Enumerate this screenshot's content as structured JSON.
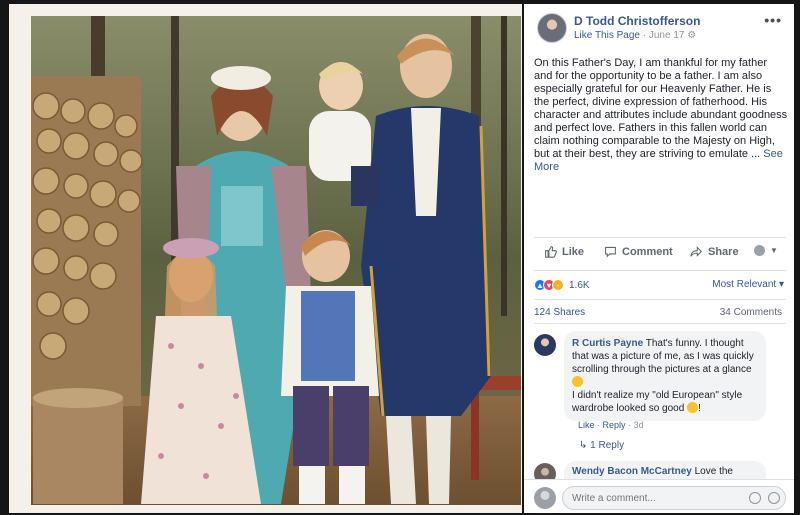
{
  "post": {
    "author": "D Todd Christofferson",
    "like_page": "Like This Page",
    "separator": "·",
    "date": "June 17",
    "body": "On this Father's Day, I am thankful for my father and for the opportunity to be a father. I am also especially grateful for our Heavenly Father. He is the perfect, divine expression of fatherhood. His character and attributes include abundant goodness and perfect love. Fathers in this fallen world can claim nothing comparable to the Majesty on High, but at their best, they are striving to emulate ...",
    "see_more": "See More",
    "more_glyph": "•••"
  },
  "actions": {
    "like": "Like",
    "comment": "Comment",
    "share": "Share"
  },
  "stats": {
    "reaction_count": "1.6K",
    "sort_label": "Most Relevant ▾",
    "shares": "124 Shares",
    "comments": "34 Comments"
  },
  "comments": [
    {
      "author": "R Curtis Payne",
      "text1": "That's funny. I thought that was a picture of me, as I was quickly scrolling through the pictures at a glance",
      "text2": "I didn't realize my \"old European\" style wardrobe looked so good",
      "text3": "!",
      "like": "Like",
      "reply": "Reply",
      "age": "3d",
      "replies": "1 Reply"
    },
    {
      "author": "Wendy Bacon McCartney",
      "text1": "Love the"
    }
  ],
  "composer": {
    "placeholder": "Write a comment..."
  },
  "colors": {
    "link": "#385898",
    "like_blue": "#1877f2",
    "love_red": "#f33e58",
    "haha_yellow": "#f7b125"
  }
}
